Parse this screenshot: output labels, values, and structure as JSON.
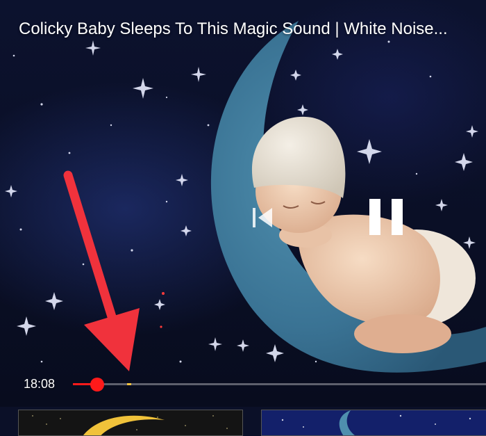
{
  "video": {
    "title": "Colicky Baby Sleeps To This Magic Sound | White Noise...",
    "current_time": "18:08",
    "progress": 0.06,
    "is_playing": true
  },
  "controls": {
    "pause_icon": "pause-icon",
    "previous_icon": "previous-icon"
  },
  "annotation": {
    "arrow_color": "#f0323c"
  },
  "colors": {
    "progress_played": "#ff1a1a",
    "progress_marker": "#f6c23e",
    "background": "#0b1028"
  },
  "recommended": [
    {
      "thumbnail": "moon-night-thumbnail"
    },
    {
      "thumbnail": "blue-moon-thumbnail"
    }
  ]
}
